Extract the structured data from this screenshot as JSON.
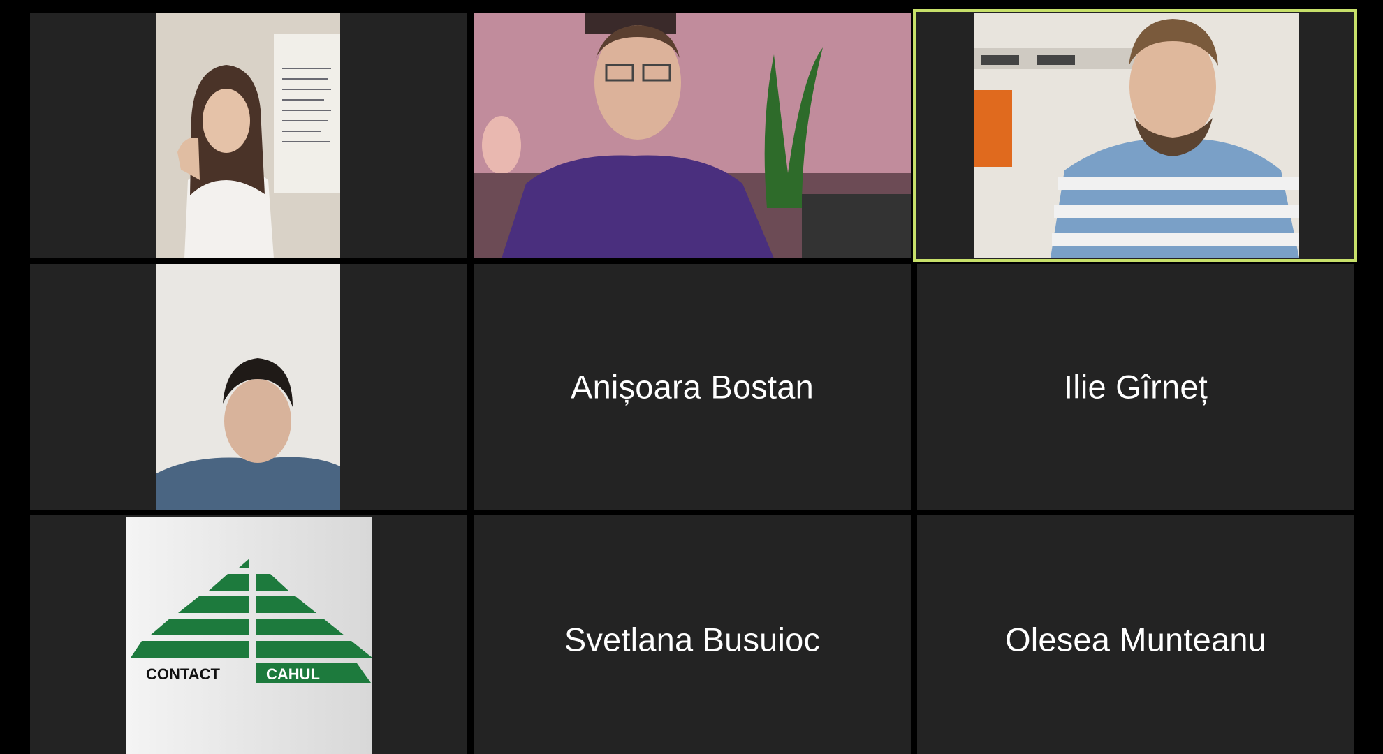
{
  "app": {
    "window": "video-meeting-gallery-view"
  },
  "tiles": [
    {
      "id": "tile-1",
      "type": "video",
      "person": "woman-with-headset",
      "active": false
    },
    {
      "id": "tile-2",
      "type": "video",
      "person": "man-in-purple-shirt",
      "active": false
    },
    {
      "id": "tile-3",
      "type": "video",
      "person": "man-in-striped-shirt",
      "active": true
    },
    {
      "id": "tile-4",
      "type": "video",
      "person": "young-man-blue-sweater",
      "active": false
    },
    {
      "id": "tile-5",
      "type": "name",
      "name": "Anișoara Bostan",
      "active": false
    },
    {
      "id": "tile-6",
      "type": "name",
      "name": "Ilie Gîrneț",
      "active": false
    },
    {
      "id": "tile-7",
      "type": "logo",
      "logo": {
        "left": "CONTACT",
        "right": "CAHUL"
      },
      "active": false
    },
    {
      "id": "tile-8",
      "type": "name",
      "name": "Svetlana Busuioc",
      "active": false
    },
    {
      "id": "tile-9",
      "type": "name",
      "name": "Olesea Munteanu",
      "active": false
    }
  ],
  "colors": {
    "background": "#000000",
    "tile": "#232323",
    "active_border": "#c7e06a",
    "logo_green": "#1d7a3d",
    "name_text": "#ffffff"
  }
}
